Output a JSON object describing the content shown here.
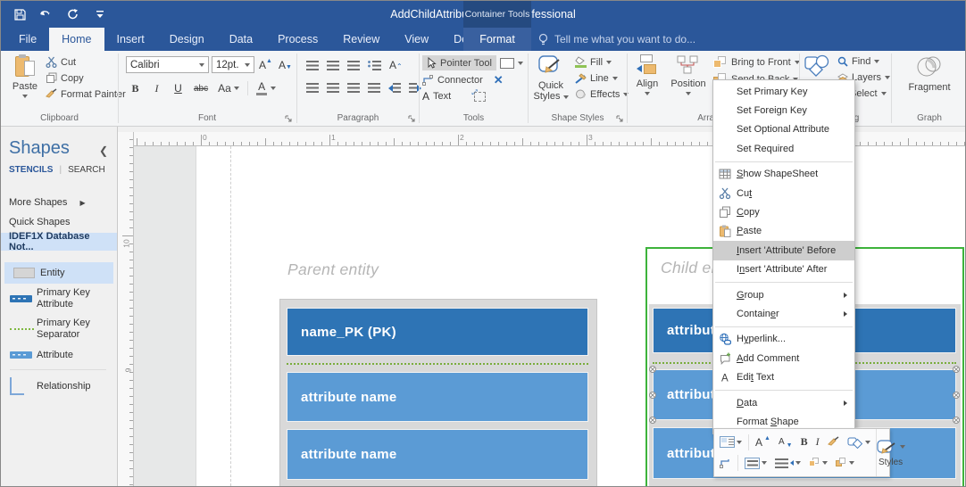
{
  "titlebar": {
    "title": "AddChildAttribute - Visio Professional",
    "contextual_group": "Container Tools"
  },
  "tabs": {
    "items": [
      "File",
      "Home",
      "Insert",
      "Design",
      "Data",
      "Process",
      "Review",
      "View",
      "Developer"
    ],
    "active": "Home",
    "contextual_tab": "Format",
    "tell_me": "Tell me what you want to do..."
  },
  "ribbon": {
    "clipboard": {
      "label": "Clipboard",
      "paste": "Paste",
      "cut": "Cut",
      "copy": "Copy",
      "format_painter": "Format Painter"
    },
    "font": {
      "label": "Font",
      "family": "Calibri",
      "size": "12pt.",
      "bold": "B",
      "italic": "I",
      "underline": "U",
      "strikethrough": "abc",
      "case_btn": "Aa",
      "color_btn": "A"
    },
    "paragraph": {
      "label": "Paragraph"
    },
    "tools": {
      "label": "Tools",
      "pointer_tool": "Pointer Tool",
      "connector": "Connector",
      "text": "Text"
    },
    "shape_styles": {
      "label": "Shape Styles",
      "quick_styles_1": "Quick",
      "quick_styles_2": "Styles",
      "fill": "Fill",
      "line": "Line",
      "effects": "Effects"
    },
    "arrange": {
      "label": "Arrange",
      "align": "Align",
      "position": "Position",
      "bring_to_front": "Bring to Front",
      "send_to_back": "Send to Back"
    },
    "editing": {
      "label": "Editing",
      "change_shape": "Change Shape",
      "find": "Find",
      "layers": "Layers",
      "select": "Select"
    },
    "graph": {
      "label": "Graph",
      "fragment": "Fragment"
    }
  },
  "shapes_panel": {
    "title": "Shapes",
    "stencils_tab": "STENCILS",
    "search_tab": "SEARCH",
    "more_shapes": "More Shapes",
    "quick_shapes": "Quick Shapes",
    "active_stencil": "IDEF1X Database Not...",
    "shapes": [
      {
        "label": "Entity",
        "icon": "entity",
        "selected": true
      },
      {
        "label": "Primary Key Attribute",
        "icon": "pkattr"
      },
      {
        "label": "Primary Key Separator",
        "icon": "pksep"
      },
      {
        "label": "Attribute",
        "icon": "attr",
        "divider_after": true
      },
      {
        "label": "Relationship",
        "icon": "rel"
      }
    ]
  },
  "canvas": {
    "hruler_labels": [
      "0",
      "1",
      "2",
      "3"
    ],
    "vruler_labels": [
      "10",
      "9"
    ],
    "parent_entity": {
      "title": "Parent entity",
      "primary_key": "name_PK (PK)",
      "attributes": [
        "attribute name",
        "attribute name"
      ]
    },
    "child_entity": {
      "title": "Child entity",
      "attributes": [
        {
          "text": "attribute name",
          "style": "dark"
        },
        {
          "text": "attribute name",
          "style": "selected"
        },
        {
          "text": "attribute name",
          "style": "normal"
        }
      ]
    }
  },
  "context_menu": {
    "items": [
      {
        "label": "Set Primary Key"
      },
      {
        "label": "Set Foreign Key"
      },
      {
        "label": "Set Optional Attribute"
      },
      {
        "label": "Set Required",
        "sep_after": true
      },
      {
        "label": "Show ShapeSheet",
        "icon": "shapesheet",
        "accel": 0
      },
      {
        "label": "Cut",
        "icon": "cut",
        "accel": 2
      },
      {
        "label": "Copy",
        "icon": "copy",
        "accel": 0
      },
      {
        "label": "Paste",
        "icon": "paste",
        "accel": 0
      },
      {
        "label": "Insert 'Attribute' Before",
        "accel": 0,
        "highlight": true
      },
      {
        "label": "Insert 'Attribute' After",
        "accel": 1,
        "sep_after": true
      },
      {
        "label": "Group",
        "accel": 0,
        "submenu": true
      },
      {
        "label": "Container",
        "accel": 7,
        "submenu": true,
        "sep_after": true
      },
      {
        "label": "Hyperlink...",
        "icon": "hyperlink",
        "accel": 1
      },
      {
        "label": "Add Comment",
        "icon": "comment",
        "accel": 0
      },
      {
        "label": "Edit Text",
        "icon": "edittext",
        "accel": 3,
        "sep_after": true
      },
      {
        "label": "Data",
        "accel": 0,
        "submenu": true
      },
      {
        "label": "Format Shape",
        "accel": 7
      }
    ]
  },
  "mini_toolbar": {
    "styles_label": "Styles"
  },
  "colors": {
    "titlebar_blue": "#2b579a",
    "entity_dark_blue": "#2e74b5",
    "entity_light_blue": "#5b9bd5",
    "container_selection_green": "#3db33b",
    "pk_separator_green": "#79ad3c",
    "selection_highlight": "#cfe1f7"
  }
}
